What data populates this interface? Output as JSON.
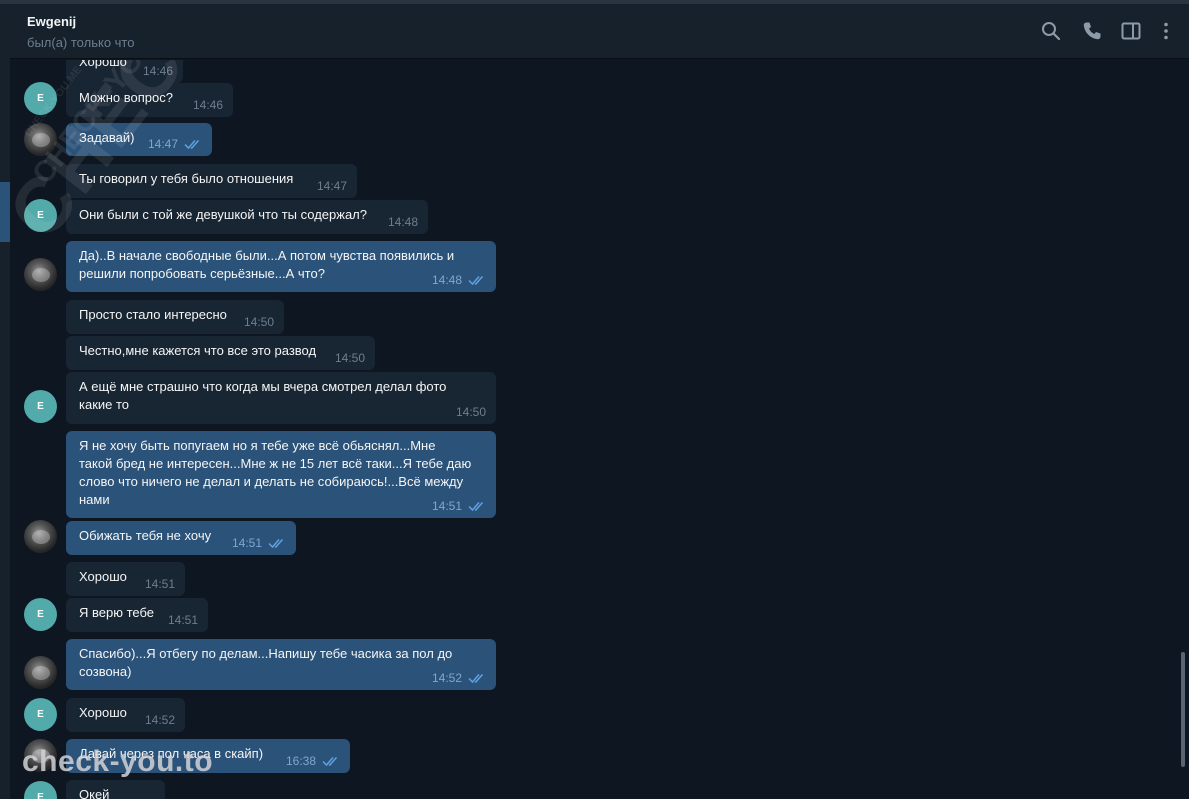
{
  "header": {
    "name": "Ewgenij",
    "status": "был(а) только что",
    "icons": [
      "search-icon",
      "phone-icon",
      "sidebar-toggle-icon",
      "more-vertical-icon"
    ]
  },
  "colors": {
    "background": "#0e1621",
    "incoming_bubble": "#182533",
    "outgoing_bubble": "#2b5278",
    "avatar_e": "#53aaaa",
    "check_color": "#5ea2e4"
  },
  "avatar_e_letter": "E",
  "messages": [
    {
      "dir": "in",
      "text": "Хорошо",
      "time": "14:46"
    },
    {
      "dir": "in",
      "text": "Можно вопрос?",
      "time": "14:46"
    },
    {
      "dir": "out",
      "text": "Задавай)",
      "time": "14:47",
      "read": true
    },
    {
      "dir": "in",
      "text": "Ты говорил у тебя было отношения",
      "time": "14:47"
    },
    {
      "dir": "in",
      "text": "Они были с той же девушкой что ты содержал?",
      "time": "14:48"
    },
    {
      "dir": "out",
      "text": "Да)..В начале свободные были...А потом чувства появились и\nрешили попробовать серьёзные...А что?",
      "time": "14:48",
      "read": true
    },
    {
      "dir": "in",
      "text": "Просто стало интересно",
      "time": "14:50"
    },
    {
      "dir": "in",
      "text": "Честно,мне кажется что все это развод",
      "time": "14:50"
    },
    {
      "dir": "in",
      "text": "А ещё мне страшно что когда мы вчера смотрел делал фото\nкакие то",
      "time": "14:50"
    },
    {
      "dir": "out",
      "text": "Я не хочу быть попугаем но я тебе уже всё обьяснял...Мне\nтакой бред не интересен...Мне ж не 15 лет всё таки...Я тебе даю\nслово что ничего не делал и делать не собираюсь!...Всё между\nнами",
      "time": "14:51",
      "read": true
    },
    {
      "dir": "out",
      "text": "Обижать тебя не хочу",
      "time": "14:51",
      "read": true
    },
    {
      "dir": "in",
      "text": "Хорошо",
      "time": "14:51"
    },
    {
      "dir": "in",
      "text": "Я верю тебе",
      "time": "14:51"
    },
    {
      "dir": "out",
      "text": "Спасибо)...Я отбегу по делам...Напишу тебе часика за пол до\nсозвона)",
      "time": "14:52",
      "read": true
    },
    {
      "dir": "in",
      "text": "Хорошо",
      "time": "14:52"
    },
    {
      "dir": "out",
      "text": "Давай через пол часа в скайп)",
      "time": "16:38",
      "read": true
    },
    {
      "dir": "in",
      "text": "Окей",
      "time": ""
    }
  ],
  "watermarks": {
    "diagonal": "CHECK-YOU.ME",
    "bottom": "check-you.to"
  }
}
